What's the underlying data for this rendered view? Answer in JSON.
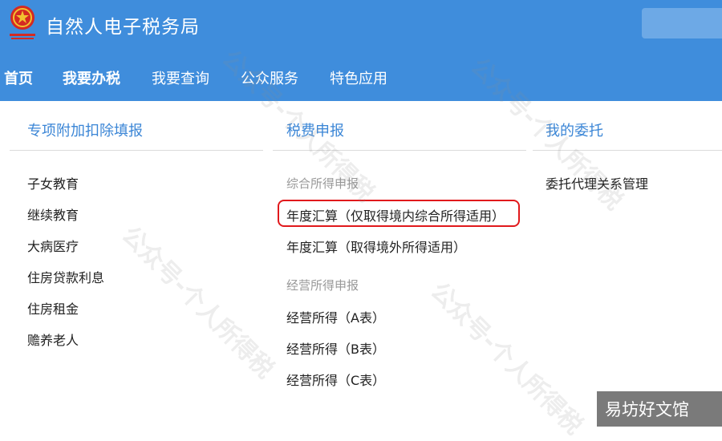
{
  "header": {
    "title": "自然人电子税务局"
  },
  "nav": {
    "items": [
      "首页",
      "我要办税",
      "我要查询",
      "公众服务",
      "特色应用"
    ]
  },
  "menu": {
    "col1": {
      "title": "专项附加扣除填报",
      "items": [
        "子女教育",
        "继续教育",
        "大病医疗",
        "住房贷款利息",
        "住房租金",
        "赡养老人"
      ]
    },
    "col2": {
      "title": "税费申报",
      "group1": {
        "heading": "综合所得申报",
        "items": [
          "年度汇算（仅取得境内综合所得适用）",
          "年度汇算（取得境外所得适用）"
        ]
      },
      "group2": {
        "heading": "经营所得申报",
        "items": [
          "经营所得（A表）",
          "经营所得（B表）",
          "经营所得（C表）"
        ]
      }
    },
    "col3": {
      "title": "我的委托",
      "items": [
        "委托代理关系管理"
      ]
    }
  },
  "watermark": {
    "text": "公众号-个人所得税"
  },
  "badge": {
    "text": "易坊好文馆"
  },
  "colors": {
    "brand_blue": "#3f8ddc",
    "link_blue": "#3b86d6",
    "highlight_red": "#e1191c"
  }
}
